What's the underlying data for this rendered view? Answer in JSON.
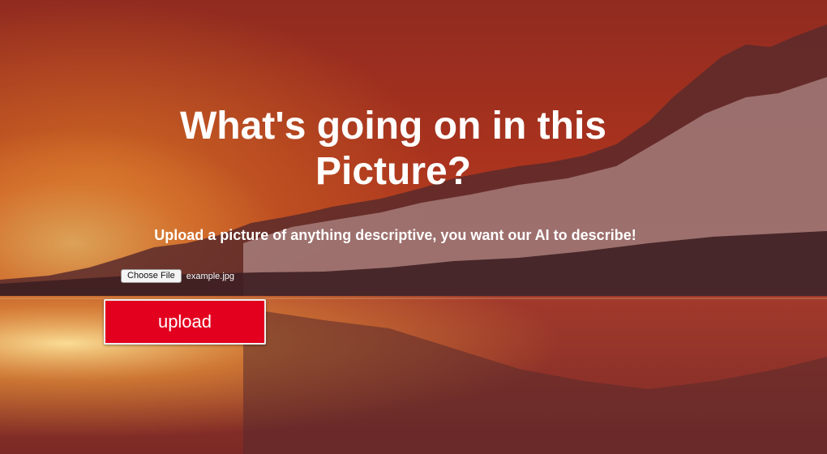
{
  "hero": {
    "headline": "What's going on in this Picture?",
    "subtitle": "Upload a picture of anything descriptive, you want our AI to describe!"
  },
  "file_input": {
    "button_label": "Choose File",
    "file_name": "example.jpg"
  },
  "actions": {
    "upload_label": "upload"
  },
  "colors": {
    "upload_button": "#e3001f",
    "text": "#ffffff"
  }
}
